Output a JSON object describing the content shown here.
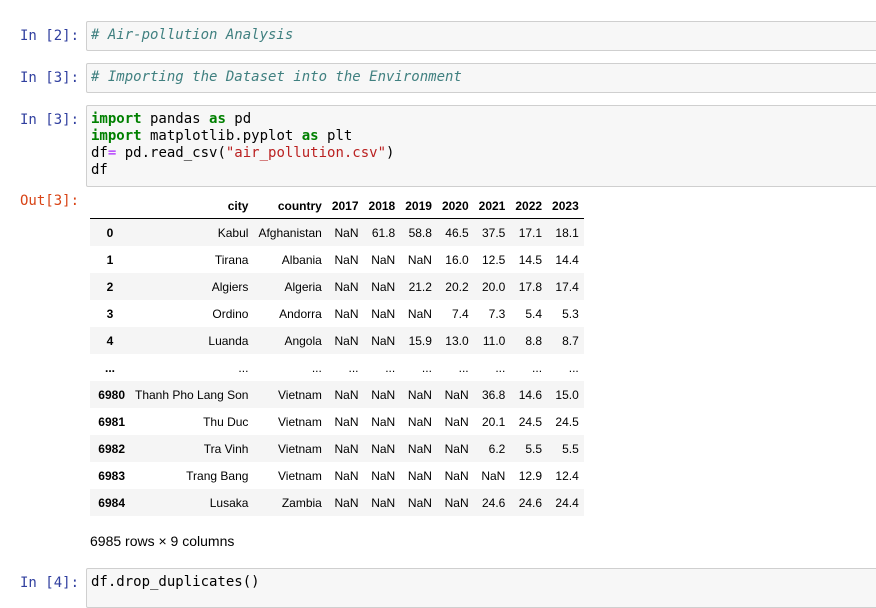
{
  "cells": [
    {
      "prompt": "In [2]:",
      "comment": "# Air-pollution Analysis"
    },
    {
      "prompt": "In [3]:",
      "comment": "# Importing the Dataset into the Environment"
    },
    {
      "prompt": "In [3]:"
    },
    {
      "prompt": "In [4]:",
      "code": "df.drop_duplicates()"
    }
  ],
  "code3": {
    "l1_kw1": "import",
    "l1_mod": " pandas ",
    "l1_kw2": "as",
    "l1_alias": " pd",
    "l2_kw1": "import",
    "l2_mod": " matplotlib.pyplot ",
    "l2_kw2": "as",
    "l2_alias": " plt",
    "l3_var": "df",
    "l3_eq": "=",
    "l3_call": " pd.read_csv(",
    "l3_str": "\"air_pollution.csv\"",
    "l3_close": ")",
    "l4": "df"
  },
  "output": {
    "prompt": "Out[3]:",
    "columns": [
      "",
      "city",
      "country",
      "2017",
      "2018",
      "2019",
      "2020",
      "2021",
      "2022",
      "2023"
    ],
    "rows": [
      [
        "0",
        "Kabul",
        "Afghanistan",
        "NaN",
        "61.8",
        "58.8",
        "46.5",
        "37.5",
        "17.1",
        "18.1"
      ],
      [
        "1",
        "Tirana",
        "Albania",
        "NaN",
        "NaN",
        "NaN",
        "16.0",
        "12.5",
        "14.5",
        "14.4"
      ],
      [
        "2",
        "Algiers",
        "Algeria",
        "NaN",
        "NaN",
        "21.2",
        "20.2",
        "20.0",
        "17.8",
        "17.4"
      ],
      [
        "3",
        "Ordino",
        "Andorra",
        "NaN",
        "NaN",
        "NaN",
        "7.4",
        "7.3",
        "5.4",
        "5.3"
      ],
      [
        "4",
        "Luanda",
        "Angola",
        "NaN",
        "NaN",
        "15.9",
        "13.0",
        "11.0",
        "8.8",
        "8.7"
      ],
      [
        "...",
        "...",
        "...",
        "...",
        "...",
        "...",
        "...",
        "...",
        "...",
        "..."
      ],
      [
        "6980",
        "Thanh Pho Lang Son",
        "Vietnam",
        "NaN",
        "NaN",
        "NaN",
        "NaN",
        "36.8",
        "14.6",
        "15.0"
      ],
      [
        "6981",
        "Thu Duc",
        "Vietnam",
        "NaN",
        "NaN",
        "NaN",
        "NaN",
        "20.1",
        "24.5",
        "24.5"
      ],
      [
        "6982",
        "Tra Vinh",
        "Vietnam",
        "NaN",
        "NaN",
        "NaN",
        "NaN",
        "6.2",
        "5.5",
        "5.5"
      ],
      [
        "6983",
        "Trang Bang",
        "Vietnam",
        "NaN",
        "NaN",
        "NaN",
        "NaN",
        "NaN",
        "12.9",
        "12.4"
      ],
      [
        "6984",
        "Lusaka",
        "Zambia",
        "NaN",
        "NaN",
        "NaN",
        "NaN",
        "24.6",
        "24.6",
        "24.4"
      ]
    ],
    "shape": "6985 rows × 9 columns"
  }
}
